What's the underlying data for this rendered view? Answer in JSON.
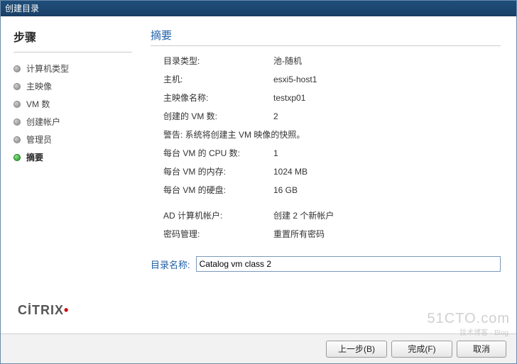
{
  "window": {
    "title": "创建目录"
  },
  "sidebar": {
    "title": "步骤",
    "steps": [
      {
        "label": "计算机类型"
      },
      {
        "label": "主映像"
      },
      {
        "label": "VM 数"
      },
      {
        "label": "创建帐户"
      },
      {
        "label": "管理员"
      },
      {
        "label": "摘要"
      }
    ]
  },
  "brand": {
    "text": "CİTRIX",
    "dot": "•"
  },
  "main": {
    "title": "摘要",
    "rows": [
      {
        "label": "目录类型:",
        "value": "池-随机"
      },
      {
        "label": "主机:",
        "value": "esxi5-host1"
      },
      {
        "label": "主映像名称:",
        "value": "testxp01"
      },
      {
        "label": "创建的 VM 数:",
        "value": "2"
      },
      {
        "label": "警告: 系统将创建主 VM 映像的快照。",
        "value": "",
        "full": true
      },
      {
        "label": "每台 VM 的 CPU 数:",
        "value": "1"
      },
      {
        "label": "每台 VM 的内存:",
        "value": "1024 MB"
      },
      {
        "label": "每台 VM 的硬盘:",
        "value": "16 GB"
      },
      {
        "gap": true
      },
      {
        "label": "AD 计算机帐户:",
        "value": "创建 2 个新帐户"
      },
      {
        "label": "密码管理:",
        "value": "重置所有密码"
      }
    ],
    "catalog_label": "目录名称:",
    "catalog_value": "Catalog vm class 2"
  },
  "footer": {
    "back": "上一步(B)",
    "finish": "完成(F)",
    "cancel": "取消"
  },
  "watermark": {
    "main": "51CTO.com",
    "sub": "技术博客 · Blog"
  }
}
